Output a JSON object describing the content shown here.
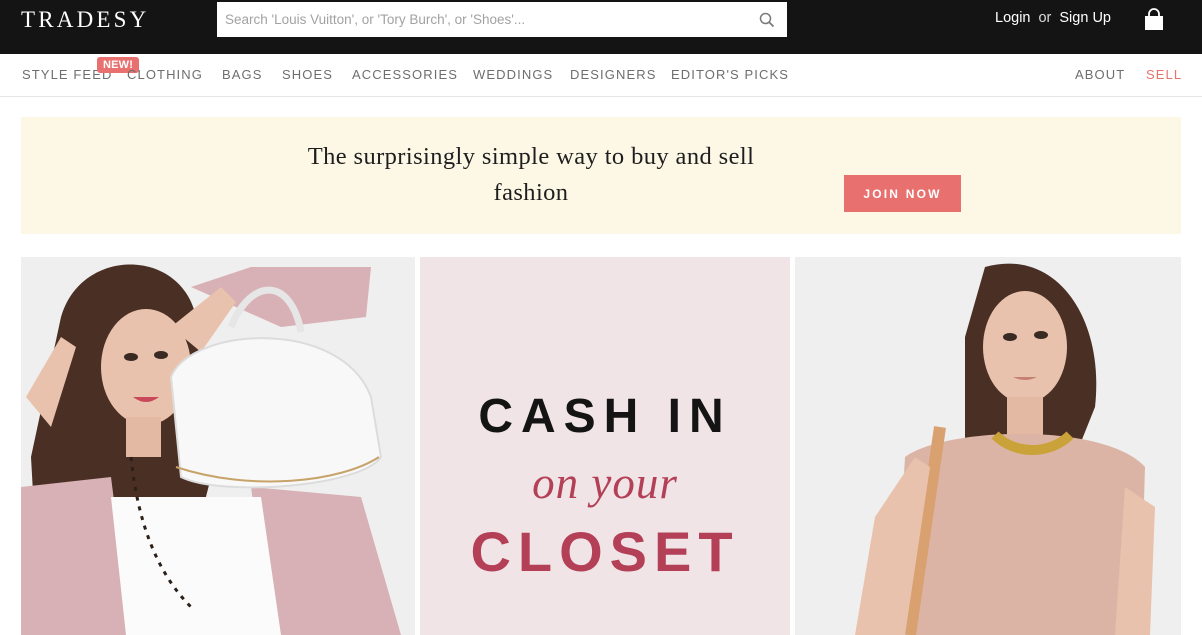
{
  "header": {
    "logo": "TRADESY",
    "search_placeholder": "Search 'Louis Vuitton', or 'Tory Burch', or 'Shoes'...",
    "login": "Login",
    "or": "or",
    "signup": "Sign Up"
  },
  "nav": {
    "badge": "NEW!",
    "items": [
      "STYLE FEED",
      "CLOTHING",
      "BAGS",
      "SHOES",
      "ACCESSORIES",
      "WEDDINGS",
      "DESIGNERS",
      "EDITOR'S PICKS"
    ],
    "about": "ABOUT",
    "sell": "SELL"
  },
  "promo": {
    "text": "The surprisingly simple way to buy and sell fashion",
    "button": "JOIN NOW"
  },
  "hero": {
    "line1": "CASH IN",
    "line2": "on your",
    "line3": "CLOSET"
  },
  "colors": {
    "accent": "#e8716f",
    "topbar": "#141414",
    "promo_bg": "#fdf8e6",
    "closet_text": "#b44057",
    "closet_bg": "#f0e4e6"
  },
  "icons": {
    "search": "search-icon",
    "bag": "shopping-bag-icon"
  }
}
